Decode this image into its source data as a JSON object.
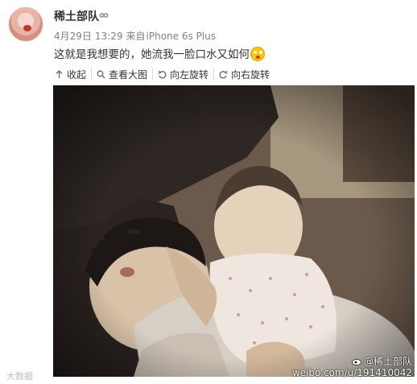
{
  "post": {
    "username": "稀土部队",
    "date": "4月29日",
    "time": "13:29",
    "source_prefix": "来自",
    "source": "iPhone 6s Plus",
    "content": "这就是我想要的，她流我一脸口水又如何"
  },
  "toolbar": {
    "collapse_label": "收起",
    "view_large_label": "查看大图",
    "rotate_left_label": "向左旋转",
    "rotate_right_label": "向右旋转"
  },
  "watermark": {
    "bottom_left": "大数据",
    "right_user": "@稀土部队",
    "right_url": "weibo.com/u/191410042"
  },
  "icons": {
    "vip": "vip-badge-icon",
    "emoji": "tongue-face-emoji-icon",
    "collapse": "arrow-up-icon",
    "view_large": "magnifier-icon",
    "rotate_left": "rotate-left-icon",
    "rotate_right": "rotate-right-icon"
  }
}
